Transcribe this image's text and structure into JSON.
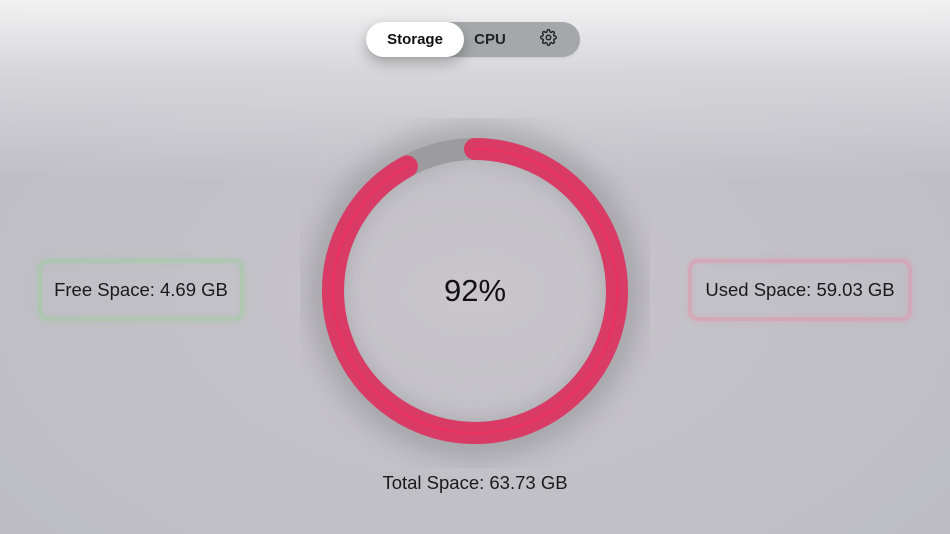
{
  "tabs": {
    "storage_label": "Storage",
    "cpu_label": "CPU",
    "settings_icon": "gear-icon",
    "active": "Storage"
  },
  "storage": {
    "free_space": "Free Space: 4.69 GB",
    "used_space": "Used Space: 59.03 GB",
    "total_space": "Total Space: 63.73 GB",
    "percent_label": "92%",
    "used_fraction": 0.92
  },
  "colors": {
    "used_arc": "#d93a66",
    "free_arc": "#9c9c9e",
    "free_border": "#8cd28c",
    "used_border": "#e68ca5"
  }
}
